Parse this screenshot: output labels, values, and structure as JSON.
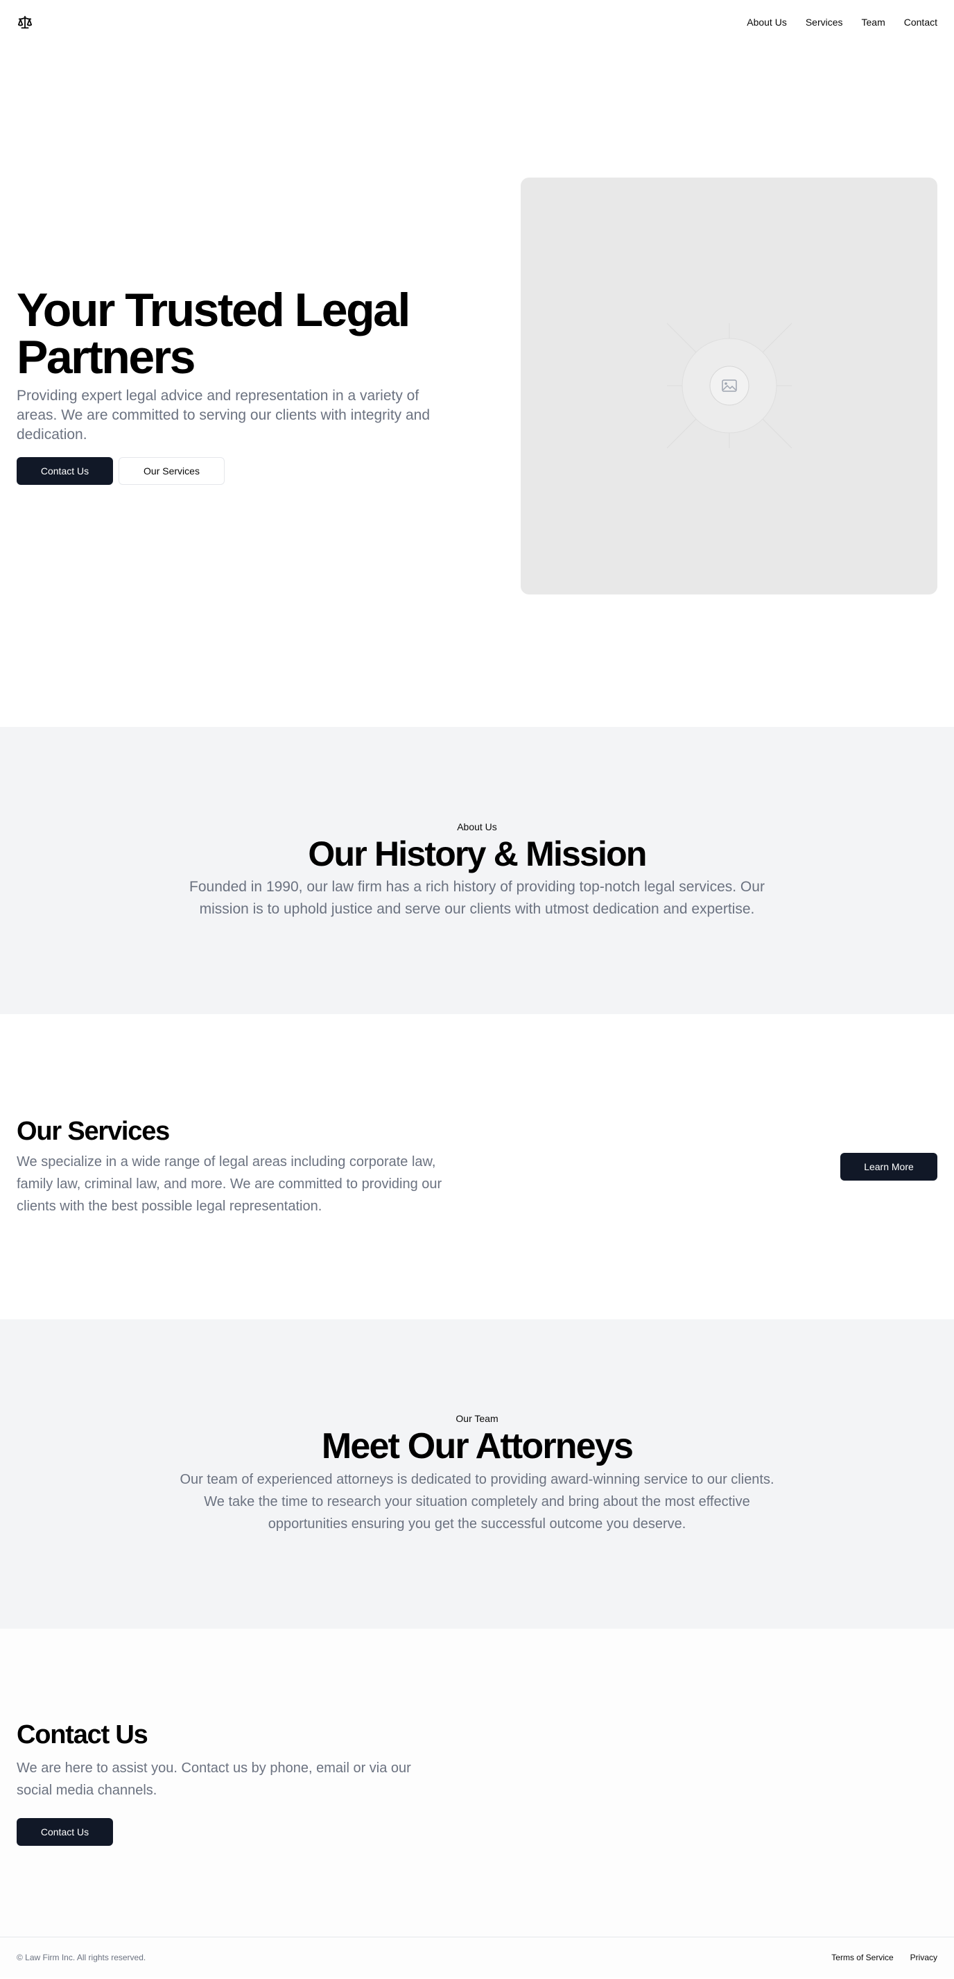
{
  "header": {
    "logo_icon": "scale-icon",
    "nav": [
      {
        "label": "About Us"
      },
      {
        "label": "Services"
      },
      {
        "label": "Team"
      },
      {
        "label": "Contact"
      }
    ]
  },
  "hero": {
    "title": "Your Trusted Legal Partners",
    "subtitle": "Providing expert legal advice and representation in a variety of areas. We are committed to serving our clients with integrity and dedication.",
    "primary_button": "Contact Us",
    "secondary_button": "Our Services",
    "image_icon": "image-placeholder-icon"
  },
  "about": {
    "eyebrow": "About Us",
    "title": "Our History & Mission",
    "body": "Founded in 1990, our law firm has a rich history of providing top-notch legal services. Our mission is to uphold justice and serve our clients with utmost dedication and expertise."
  },
  "services": {
    "title": "Our Services",
    "body": "We specialize in a wide range of legal areas including corporate law, family law, criminal law, and more. We are committed to providing our clients with the best possible legal representation.",
    "button": "Learn More"
  },
  "team": {
    "eyebrow": "Our Team",
    "title": "Meet Our Attorneys",
    "body": "Our team of experienced attorneys is dedicated to providing award-winning service to our clients. We take the time to research your situation completely and bring about the most effective opportunities ensuring you get the successful outcome you deserve."
  },
  "contact": {
    "title": "Contact Us",
    "body": "We are here to assist you. Contact us by phone, email or via our social media channels.",
    "button": "Contact Us"
  },
  "footer": {
    "copyright": "© Law Firm Inc. All rights reserved.",
    "links": [
      {
        "label": "Terms of Service"
      },
      {
        "label": "Privacy"
      }
    ]
  }
}
